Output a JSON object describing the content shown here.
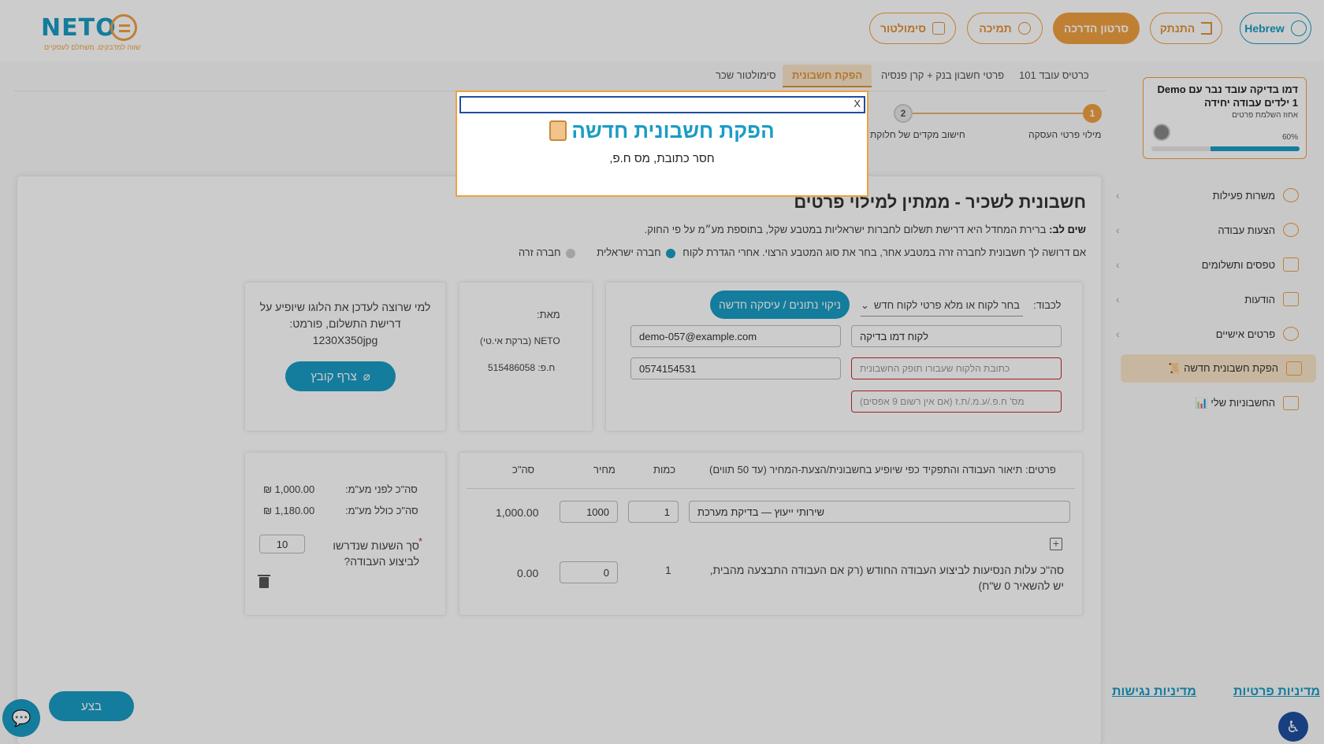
{
  "header": {
    "logo_text": "NETO",
    "logo_tagline": "שווה למדבקים. משתלם לעסקיים",
    "buttons": {
      "simulator": "סימולטור",
      "support": "תמיכה",
      "tutorial": "סרטון הדרכה",
      "logout": "התנתק",
      "language": "Hebrew"
    }
  },
  "tabs": [
    {
      "label": "כרטיס עובד 101"
    },
    {
      "label": "פרטי חשבון בנק + קרן פנסיה"
    },
    {
      "label": "הפקת חשבונית"
    },
    {
      "label": "סימולטור שכר"
    }
  ],
  "steps": [
    {
      "num": "1",
      "label": "מילוי פרטי העסקה"
    },
    {
      "num": "2",
      "label": "חישוב מקדים של חלוקת"
    }
  ],
  "profile": {
    "name": "Demo דמו בדיקה עובד נבר עם 1 ילדים עבודה יחידה",
    "subtitle": "אחוז השלמת פרטים",
    "progress_label": "60%",
    "progress": 0.6
  },
  "sidebar": [
    {
      "label": "משרות פעילות",
      "icon": "gear-icon"
    },
    {
      "label": "הצעות עבודה",
      "icon": "mic-icon"
    },
    {
      "label": "טפסים ותשלומים",
      "icon": "document-icon"
    },
    {
      "label": "הודעות",
      "icon": "envelope-icon"
    },
    {
      "label": "פרטים אישיים",
      "icon": "user-icon"
    },
    {
      "label": "📜 הפקת חשבונית חדשה",
      "icon": "invoice-icon"
    },
    {
      "label": "📊 החשבוניות שלי",
      "icon": "folder-icon"
    }
  ],
  "policies": {
    "privacy": "מדיניות פרטיות",
    "accessibility": "מדיניות נגישות"
  },
  "main": {
    "title": "חשבונית לשכיר - ממתין למילוי פרטים",
    "note_bold": "שים לב:",
    "note_text": " ברירת המחדל היא דרישת תשלום לחברות ישראליות במטבע שקל, בתוספת מע״מ על פי החוק.",
    "currency_note": "אם דרושה לך חשבונית לחברה זרה במטבע אחר, בחר את סוג המטבע הרצוי. אחרי הגדרת לקוח",
    "radio_israeli": "חברה ישראלית",
    "radio_foreign": "חברה זרה",
    "to_label": "לכבוד:",
    "client_select": "בחר לקוח או מלא פרטי לקוח חדש",
    "clear_button": "ניקוי נתונים / עיסקה חדשה",
    "client_name": "לקוח דמו בדיקה",
    "client_email": "demo-057@example.com",
    "client_address_placeholder": "כתובת הלקוח שעבורו תופק החשבונית",
    "client_phone": "0574154531",
    "client_id_placeholder": "מס' ח.פ./ע.מ./ת.ז (אם אין רשום 9 אפסים)",
    "from_label": "מאת:",
    "from_company": "NETO (ברקת אי.טי)",
    "from_id": "ח.פ: 515486058",
    "logo_note": "למי שרוצה לעדכן את הלוגו שיופיע על דרישת התשלום, פורמט: 1230X350jpg",
    "attach_button": "צרף קובץ",
    "items_header": "פרטים: תיאור העבודה והתפקיד כפי שיופיע בחשבונית/הצעת-המחיר (עד 50 תווים)",
    "col_qty": "כמות",
    "col_price": "מחיר",
    "col_total": "סה\"כ",
    "item_desc": "שירותי ייעוץ — בדיקת מערכת",
    "item_qty": "1",
    "item_price": "1000",
    "item_total": "1,000.00",
    "travel_label": "סה\"כ עלות הנסיעות לביצוע העבודה החודש (רק אם העבודה התבצעה מהבית, יש להשאיר 0 ש\"ח)",
    "travel_qty": "1",
    "travel_price": "0",
    "travel_total": "0.00",
    "sum_before_label": "סה\"כ לפני מע\"מ:",
    "sum_before_value": "₪ 1,000.00",
    "sum_after_label": "סה\"כ כולל מע\"מ:",
    "sum_after_value": "₪ 1,180.00",
    "hours_label": "סך השעות שנדרשו לביצוע העבודה?",
    "hours_required": "*",
    "hours_value": "10",
    "submit_button": "בצע"
  },
  "modal": {
    "close": "X",
    "title": "הפקת חשבונית חדשה",
    "message": "חסר כתובת, מס ח.פ,"
  },
  "colors": {
    "accent_orange": "#f0a040",
    "brand_blue": "#1a9cc4",
    "error_red": "#c72a2a"
  }
}
